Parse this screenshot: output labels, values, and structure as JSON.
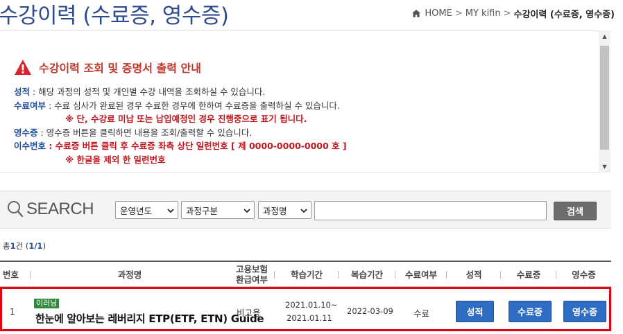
{
  "header": {
    "title": "수강이력 (수료증, 영수증)",
    "breadcrumb": {
      "home": "HOME",
      "sep1": ">",
      "section": "MY kifin",
      "sep2": ">",
      "current": "수강이력 (수료증, 영수증)"
    }
  },
  "notice": {
    "title": "수강이력 조회 및 증명서 출력 안내",
    "lines": [
      {
        "term": "성적",
        "text": " : 해당 과정의 성적 및 개인별 수강 내역을 조회하실 수 있습니다."
      },
      {
        "term": "수료여부",
        "text": " : 수료 심사가 완료된 경우 수료한 경우에 한하여 수료증을 출력하실 수 있습니다."
      },
      {
        "red": "※ 단, 수강료 미납 또는 납입예정인 경우 진행중으로 표기 됩니다."
      },
      {
        "term": "영수증",
        "text": " : 영수증 버튼을 클릭하면 내용을 조회/출력할 수 있습니다."
      },
      {
        "term": "이수번호",
        "sep": " : ",
        "red": "수료증 버튼 클릭 후 수료증 좌측 상단 일련번호 [ 제 0000-0000-0000 호 ]"
      },
      {
        "red": "※ 한글을 제외 한 일련번호"
      }
    ]
  },
  "search": {
    "label": "SEARCH",
    "year_select": "운영년도",
    "type_select": "과정구분",
    "name_select": "과정명",
    "input_value": "",
    "button": "검색"
  },
  "count": {
    "prefix": "총",
    "total": "1",
    "unit": "건",
    "page_open": " (",
    "page": "1/1",
    "page_close": ")"
  },
  "table": {
    "headers": {
      "no": "번호",
      "course": "과정명",
      "insurance_1": "고용보험",
      "insurance_2": "환급여부",
      "study": "학습기간",
      "review": "복습기간",
      "status": "수료여부",
      "grade": "성적",
      "cert": "수료증",
      "receipt": "영수증"
    },
    "rows": [
      {
        "no": "1",
        "badge": "이러닝",
        "course": "한눈에 알아보는 레버리지 ETP(ETF, ETN) Guide",
        "insurance": "비고용",
        "study_start": "2021.01.10~",
        "study_end": "2021.01.11",
        "review": "2022-03-09",
        "status": "수료",
        "grade_btn": "성적",
        "cert_btn": "수료증",
        "receipt_btn": "영수증"
      }
    ]
  },
  "colors": {
    "title": "#2d4a8e",
    "accent_red": "#c0161e",
    "button_blue": "#2f6cc4",
    "badge_green": "#2e8b3c",
    "highlight_border": "#e60012"
  }
}
